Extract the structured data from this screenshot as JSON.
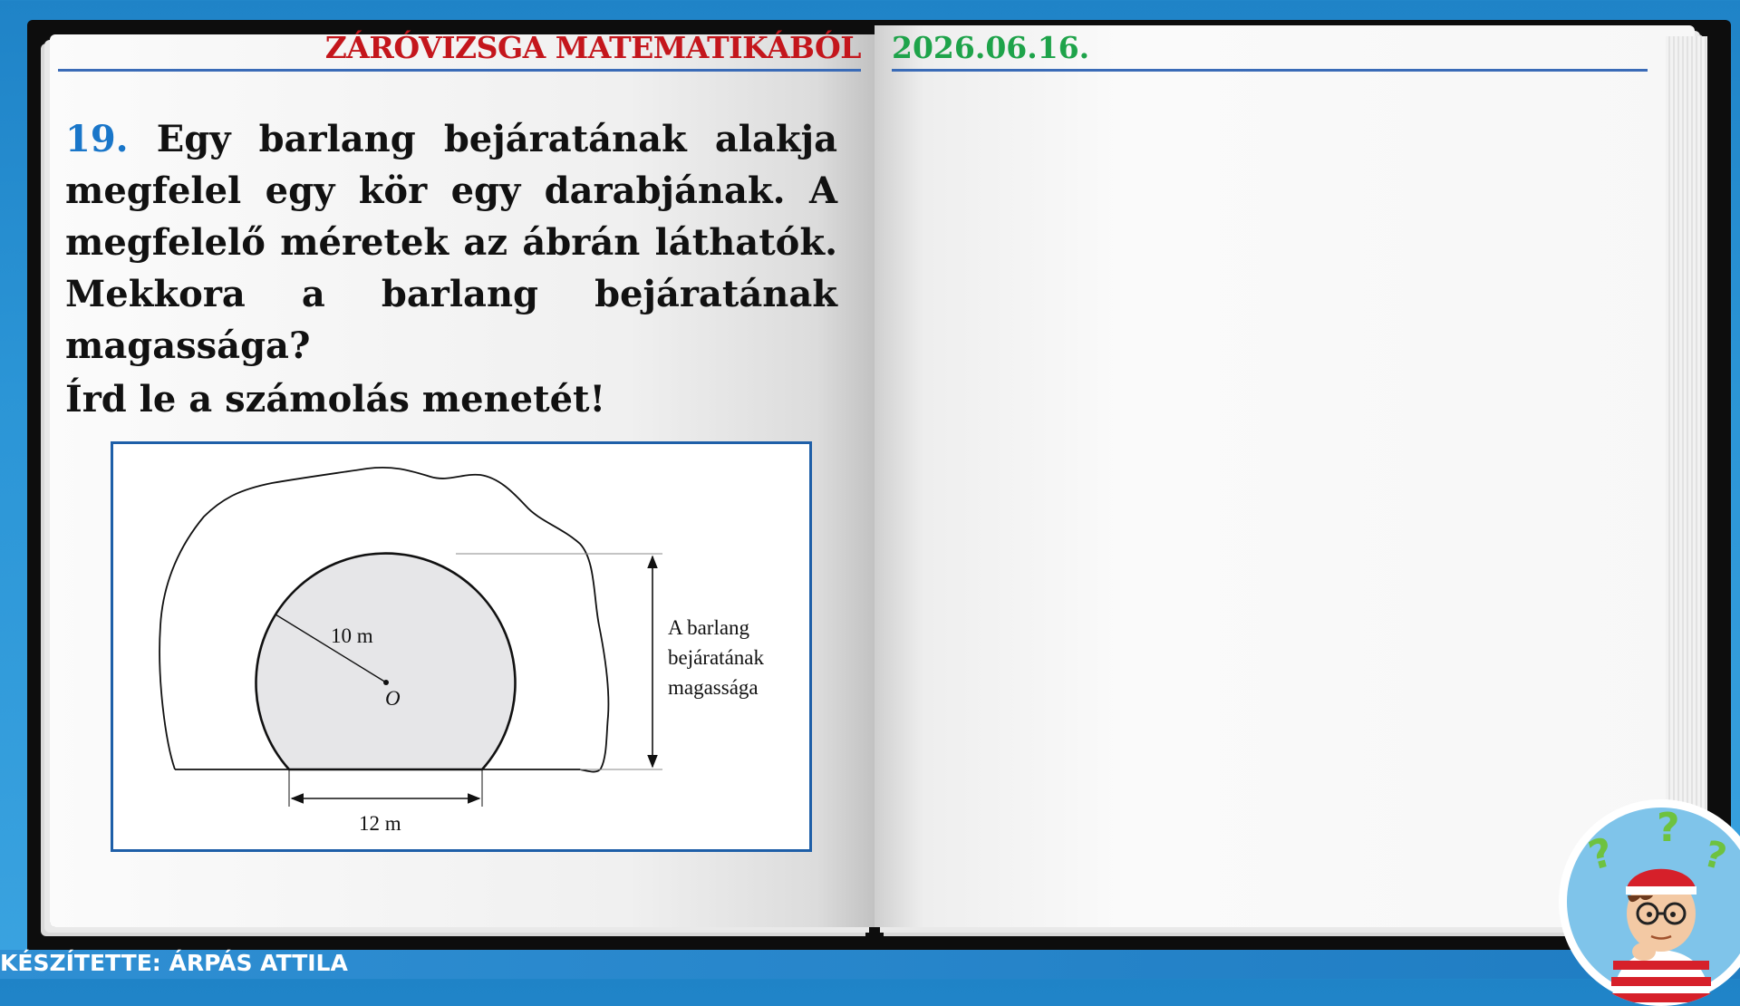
{
  "header": {
    "title": "ZÁRÓVIZSGA MATEMATIKÁBÓL",
    "date": "2026.06.16."
  },
  "question": {
    "number": "19.",
    "text": "Egy barlang bejáratának alakja megfelel egy kör egy darabjának. A megfelelő méretek az ábrán láthatók. Mekkora a barlang bejáratának magassága?",
    "instruction": "Írd le a számolás menetét!"
  },
  "figure": {
    "radius_label": "10 m",
    "center_label": "O",
    "chord_label": "12 m",
    "height_label_line1": "A barlang",
    "height_label_line2": "bejáratának",
    "height_label_line3": "magassága"
  },
  "footer": {
    "author": "KÉSZÍTETTE: ÁRPÁS ATTILA"
  },
  "colors": {
    "title_red": "#c4161c",
    "date_green": "#1ea34a",
    "number_blue": "#1976c9",
    "rule_blue": "#3a6bb7",
    "background_blue": "#2b95d6"
  },
  "icons": {
    "avatar": "thinking-boy-with-question-marks"
  }
}
